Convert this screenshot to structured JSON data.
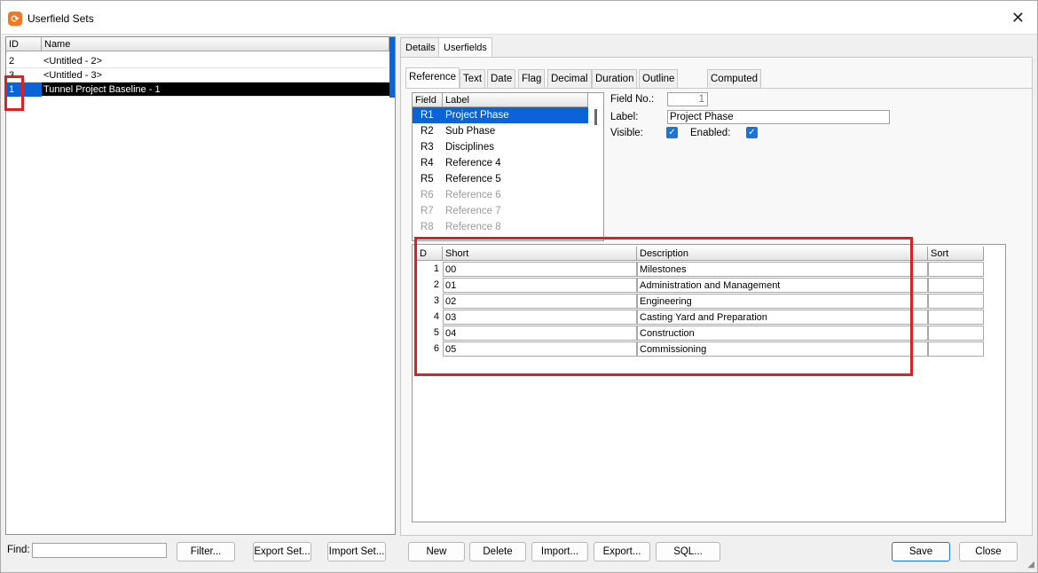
{
  "window": {
    "title": "Userfield Sets"
  },
  "sets_list": {
    "columns": [
      "ID",
      "Name"
    ],
    "rows": [
      {
        "id": "2",
        "name": "<Untitled - 2>"
      },
      {
        "id": "3",
        "name": "<Untitled - 3>"
      },
      {
        "id": "1",
        "name": "Tunnel Project Baseline - 1",
        "selected": true
      }
    ]
  },
  "tabs": [
    "Details",
    "Userfields"
  ],
  "active_tab": "Userfields",
  "subtabs": [
    "Reference",
    "Text",
    "Date",
    "Flag",
    "Decimal",
    "Duration",
    "Outline Codes",
    "Computed"
  ],
  "active_subtab": "Reference",
  "field_list": {
    "columns": [
      "Field",
      "Label"
    ],
    "rows": [
      {
        "code": "R1",
        "label": "Project Phase",
        "selected": true
      },
      {
        "code": "R2",
        "label": "Sub Phase"
      },
      {
        "code": "R3",
        "label": "Disciplines"
      },
      {
        "code": "R4",
        "label": "Reference 4"
      },
      {
        "code": "R5",
        "label": "Reference 5"
      },
      {
        "code": "R6",
        "label": "Reference 6",
        "disabled": true
      },
      {
        "code": "R7",
        "label": "Reference 7",
        "disabled": true
      },
      {
        "code": "R8",
        "label": "Reference 8",
        "disabled": true
      }
    ]
  },
  "properties": {
    "field_no_label": "Field No.:",
    "field_no_value": "1",
    "label_label": "Label:",
    "label_value": "Project Phase",
    "visible_label": "Visible:",
    "enabled_label": "Enabled:",
    "visible": true,
    "enabled": true
  },
  "values_grid": {
    "columns": [
      "D",
      "Short",
      "Description",
      "Sort"
    ],
    "rows": [
      {
        "num": "1",
        "short": "00",
        "description": "Milestones",
        "sort": ""
      },
      {
        "num": "2",
        "short": "01",
        "description": "Administration and Management",
        "sort": ""
      },
      {
        "num": "3",
        "short": "02",
        "description": "Engineering",
        "sort": ""
      },
      {
        "num": "4",
        "short": "03",
        "description": "Casting Yard and Preparation",
        "sort": ""
      },
      {
        "num": "5",
        "short": "04",
        "description": "Construction",
        "sort": ""
      },
      {
        "num": "6",
        "short": "05",
        "description": "Commissioning",
        "sort": ""
      }
    ]
  },
  "bottom": {
    "find_label": "Find:",
    "find_value": "",
    "buttons": {
      "filter": "Filter...",
      "export_set": "Export Set...",
      "import_set": "Import Set...",
      "new": "New",
      "delete": "Delete",
      "import": "Import...",
      "export": "Export...",
      "sql": "SQL...",
      "save": "Save",
      "close": "Close"
    }
  },
  "colors": {
    "selection_blue": "#0a64d8",
    "highlight_red": "#e02020",
    "app_icon_orange": "#f07a22"
  }
}
